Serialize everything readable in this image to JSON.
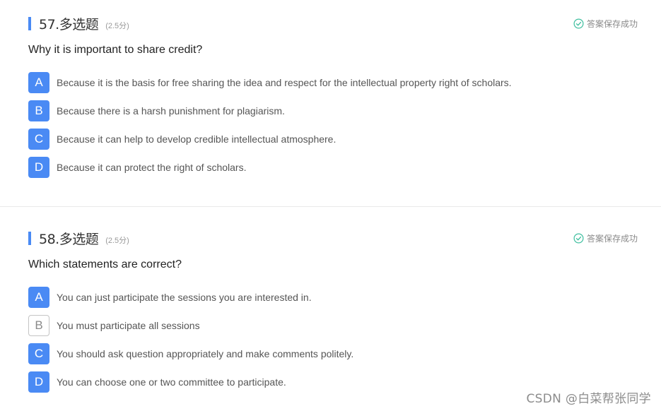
{
  "questions": [
    {
      "number_type": "57.多选题",
      "score": "(2.5分)",
      "status": "答案保存成功",
      "text": "Why it is important to share credit?",
      "options": [
        {
          "letter": "A",
          "text": "Because it is the basis for free sharing the idea and respect for the intellectual property right of scholars.",
          "selected": true
        },
        {
          "letter": "B",
          "text": "Because there is a harsh punishment for plagiarism.",
          "selected": true
        },
        {
          "letter": "C",
          "text": "Because it can help to develop credible intellectual atmosphere.",
          "selected": true
        },
        {
          "letter": "D",
          "text": "Because it can protect the right of scholars.",
          "selected": true
        }
      ]
    },
    {
      "number_type": "58.多选题",
      "score": "(2.5分)",
      "status": "答案保存成功",
      "text": "Which statements are correct?",
      "options": [
        {
          "letter": "A",
          "text": "You can just participate the sessions you are interested in.",
          "selected": true
        },
        {
          "letter": "B",
          "text": "You must participate all sessions",
          "selected": false
        },
        {
          "letter": "C",
          "text": "You should ask question appropriately and make comments politely.",
          "selected": true
        },
        {
          "letter": "D",
          "text": "You can choose one or two committee to participate.",
          "selected": true
        }
      ]
    }
  ],
  "watermark": "CSDN @白菜帮张同学",
  "colors": {
    "accent": "#4a8af4",
    "success": "#3fbf9f"
  },
  "icons": {
    "saved": "check-circle-icon"
  }
}
